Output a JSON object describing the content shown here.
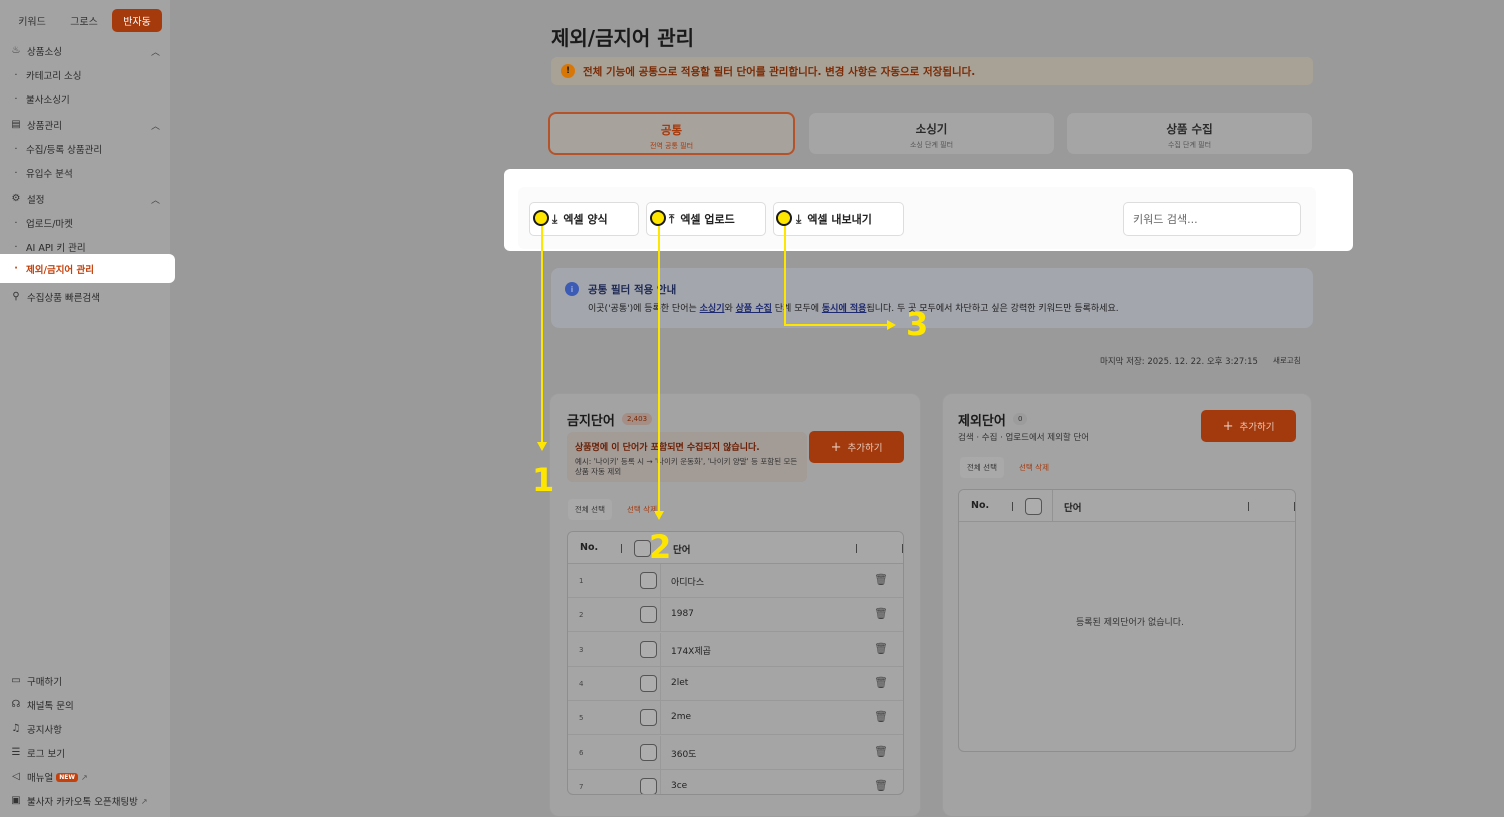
{
  "sidebar": {
    "top_tabs": [
      "키워드",
      "그로스",
      "반자동"
    ],
    "sections": {
      "sourcing": {
        "label": "상품소싱",
        "items": [
          "카테고리 소싱",
          "불사소싱기"
        ]
      },
      "product": {
        "label": "상품관리",
        "items": [
          "수집/등록 상품관리",
          "유입수 분석"
        ]
      },
      "settings": {
        "label": "설정",
        "items": [
          "업로드/마켓",
          "AI API 키 관리",
          "제외/금지어 관리"
        ]
      },
      "quick_search": "수집상품 빠른검색"
    },
    "bottom": [
      "구매하기",
      "채널톡 문의",
      "공지사항",
      "로그 보기",
      "매뉴얼",
      "불사자 카카오톡 오픈채팅방"
    ],
    "new_badge": "NEW"
  },
  "main": {
    "title": "제외/금지어 관리",
    "notice": "전체 기능에 공통으로 적용할 필터 단어를 관리합니다. 변경 사항은 자동으로 저장됩니다.",
    "mode_tabs": [
      {
        "title": "공통",
        "sub": "전역 공통 필터"
      },
      {
        "title": "소싱기",
        "sub": "소싱 단계 필터"
      },
      {
        "title": "상품 수집",
        "sub": "수집 단계 필터"
      }
    ],
    "toolbar": {
      "excel_template": "엑셀 양식",
      "excel_upload": "엑셀 업로드",
      "excel_export": "엑셀 내보내기",
      "search_placeholder": "키워드 검색..."
    },
    "info": {
      "title": "공통 필터 적용 안내",
      "desc_pre": "이곳('공통')에 등록한 단어는 ",
      "desc_b1": "소싱기",
      "desc_mid1": "와 ",
      "desc_b2": "상품 수집",
      "desc_mid2": " 단계 모두에 ",
      "desc_b3": "동시에 적용",
      "desc_post": "됩니다. 두 곳 모두에서 차단하고 싶은 강력한 키워드만 등록하세요."
    },
    "last_saved": "마지막 저장: 2025. 12. 22. 오후 3:27:15",
    "refresh": "새로고침",
    "banned": {
      "title": "금지단어",
      "count": "2,403",
      "add": "추가하기",
      "warn_title": "상품명에 이 단어가 포함되면 수집되지 않습니다.",
      "warn_desc": "예시: '나이키' 등록 시 → '나이키 운동화', '나이키 양말' 등 포함된 모든 상품 자동 제외",
      "select_all": "전체 선택",
      "delete_selected": "선택 삭제",
      "col_no": "No.",
      "col_word": "단어",
      "rows": [
        {
          "no": "1",
          "word": "아디다스"
        },
        {
          "no": "2",
          "word": "1987"
        },
        {
          "no": "3",
          "word": "174X제곱"
        },
        {
          "no": "4",
          "word": "2let"
        },
        {
          "no": "5",
          "word": "2me"
        },
        {
          "no": "6",
          "word": "360도"
        },
        {
          "no": "7",
          "word": "3ce"
        }
      ]
    },
    "excluded": {
      "title": "제외단어",
      "count": "0",
      "subtitle": "검색 · 수집 · 업로드에서 제외할 단어",
      "add": "추가하기",
      "select_all": "전체 선택",
      "delete_selected": "선택 삭제",
      "col_no": "No.",
      "col_word": "단어",
      "empty": "등록된 제외단어가 없습니다."
    }
  },
  "annotations": {
    "step1": "1",
    "step2": "2",
    "step3": "3",
    "color": "#ffe600"
  }
}
